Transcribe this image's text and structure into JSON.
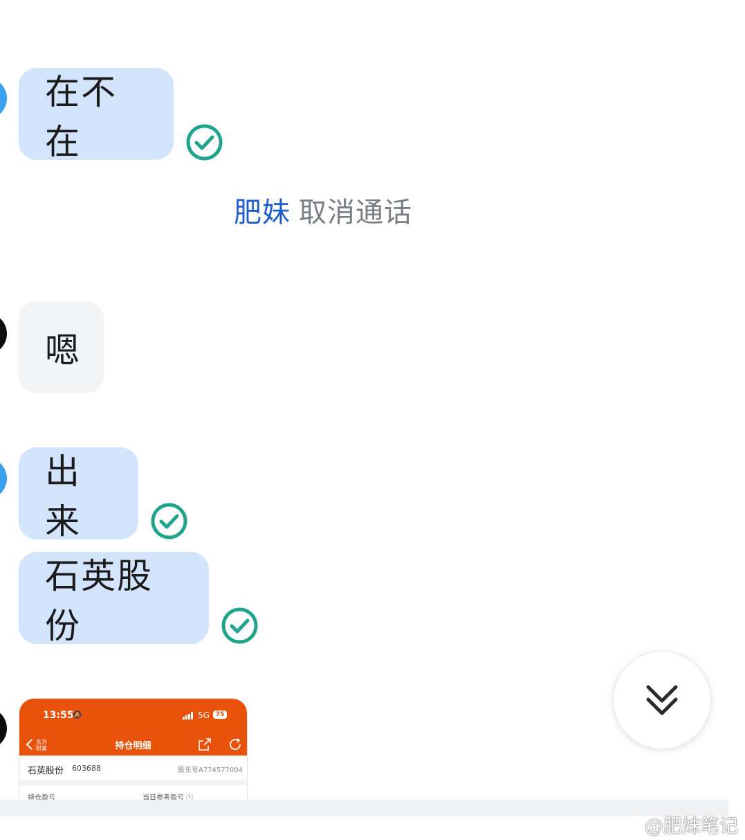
{
  "messages": [
    {
      "text": "在不在",
      "side": "mine"
    },
    {
      "system_name": "肥妹",
      "system_action": "取消通话"
    },
    {
      "text": "嗯",
      "side": "theirs"
    },
    {
      "text": "出来",
      "side": "mine"
    },
    {
      "text": "石英股份",
      "side": "mine"
    }
  ],
  "image_preview": {
    "time": "13:55",
    "network": "5G",
    "battery": "75",
    "logo_text": "东方财富",
    "title": "持仓明细",
    "stock_name": "石英股份",
    "stock_code": "603688",
    "holder_id": "股东号A774577004",
    "label_left": "持仓盈亏",
    "label_right": "当日参考盈亏 ⓘ"
  },
  "watermark": "@肥妹笔记",
  "colors": {
    "bubble_mine": "#d3e4fd",
    "bubble_theirs": "#f3f4f6",
    "check_green": "#21a38c",
    "system_name_blue": "#1f5bc9",
    "preview_orange": "#e8520b"
  },
  "icons": {
    "read_check": "check-circle-icon",
    "scroll_down": "double-chevron-down-icon",
    "weibo": "weibo-logo-icon"
  }
}
